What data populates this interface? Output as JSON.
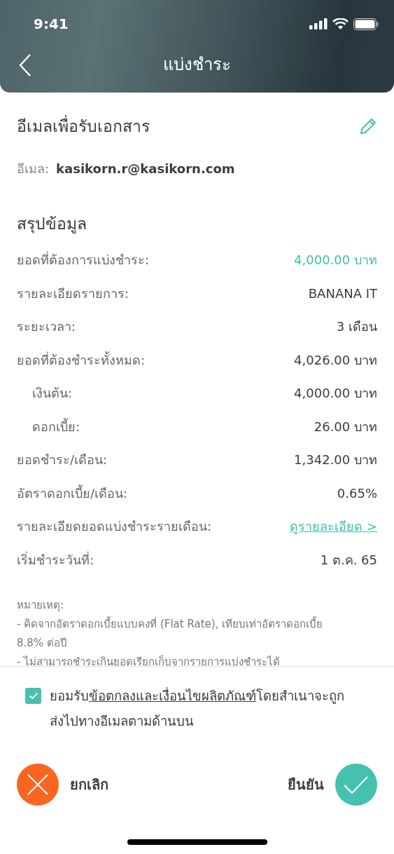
{
  "status_bar": {
    "time": "9:41"
  },
  "nav": {
    "title": "แบ่งชำระ"
  },
  "email_section": {
    "title": "อีเมลเพื่อรับเอกสาร",
    "label": "อีเมล:",
    "value": "kasikorn.r@kasikorn.com"
  },
  "summary": {
    "title": "สรุปข้อมูล",
    "rows": [
      {
        "label": "ยอดที่ต้องการแบ่งชำระ:",
        "value": "4,000.00 บาท",
        "kind": "highlight",
        "indented": false
      },
      {
        "label": "รายละเอียดรายการ:",
        "value": "BANANA IT",
        "kind": "plain",
        "indented": false
      },
      {
        "label": "ระยะเวลา:",
        "value": "3 เดือน",
        "kind": "plain",
        "indented": false
      },
      {
        "label": "ยอดที่ต้องชำระทั้งหมด:",
        "value": "4,026.00 บาท",
        "kind": "plain",
        "indented": false
      },
      {
        "label": "เงินต้น:",
        "value": "4,000.00 บาท",
        "kind": "plain",
        "indented": true
      },
      {
        "label": "ดอกเบี้ย:",
        "value": "26.00 บาท",
        "kind": "plain",
        "indented": true
      },
      {
        "label": "ยอดชำระ/เดือน:",
        "value": "1,342.00 บาท",
        "kind": "plain",
        "indented": false
      },
      {
        "label": "อัตราดอกเบี้ย/เดือน:",
        "value": "0.65%",
        "kind": "plain",
        "indented": false
      },
      {
        "label": "รายละเอียดยอดแบ่งชำระรายเดือน:",
        "value": "ดูรายละเอียด >",
        "kind": "link",
        "indented": false
      },
      {
        "label": "เริ่มชำระวันที่:",
        "value": "1 ต.ค. 65",
        "kind": "plain",
        "indented": false
      }
    ]
  },
  "notes": {
    "title": "หมายเหตุ:",
    "lines": [
      "- คิดจากอัตราดอกเบี้ยแบบคงที่ (Flat Rate), เทียบเท่าอัตราดอกเบี้ย 8.8% ต่อปี",
      "- ไม่สามารถชำระเกินยอดเรียกเก็บจากรายการแบ่งชำระได้"
    ]
  },
  "consent": {
    "checked": true,
    "before": "ยอมรับ",
    "link": "ข้อตกลงและเงื่อนไขผลิตภัณฑ์",
    "after": "โดยสำเนาจะถูกส่งไปทางอีเมลตามด้านบน"
  },
  "actions": {
    "cancel": "ยกเลิก",
    "confirm": "ยืนยัน"
  }
}
